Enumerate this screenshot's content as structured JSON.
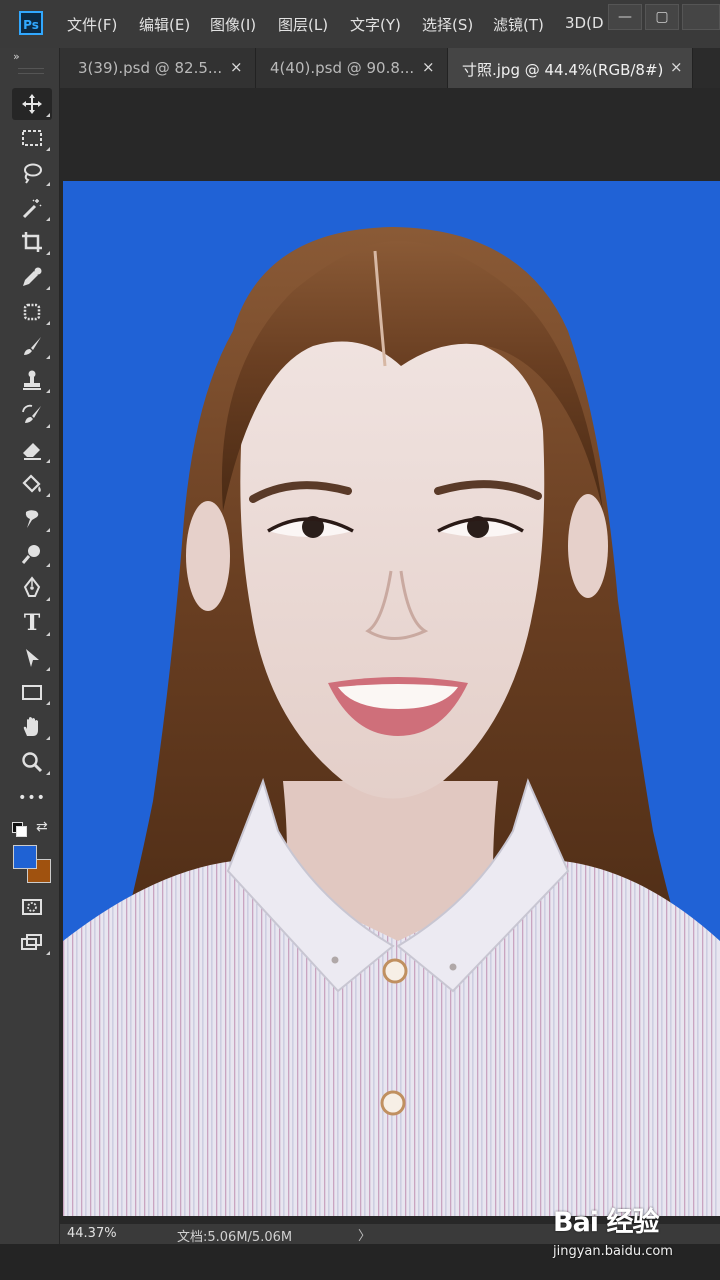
{
  "app": {
    "logo": "Ps"
  },
  "menu": [
    {
      "label": "文件(F)"
    },
    {
      "label": "编辑(E)"
    },
    {
      "label": "图像(I)"
    },
    {
      "label": "图层(L)"
    },
    {
      "label": "文字(Y)"
    },
    {
      "label": "选择(S)"
    },
    {
      "label": "滤镜(T)"
    },
    {
      "label": "3D(D"
    }
  ],
  "window_controls": {
    "minimize": "—",
    "restore": "▢"
  },
  "tabs": [
    {
      "label": "3(39).psd @ 82.5...",
      "close": "×",
      "active": false
    },
    {
      "label": "4(40).psd @ 90.8...",
      "close": "×",
      "active": false
    },
    {
      "label": "寸照.jpg @ 44.4%(RGB/8#)",
      "close": "×",
      "active": true
    }
  ],
  "toolbar": {
    "collapse": "»",
    "tools": [
      {
        "icon": "move-icon",
        "selected": true
      },
      {
        "icon": "marquee-icon"
      },
      {
        "icon": "lasso-icon"
      },
      {
        "icon": "magic-wand-icon"
      },
      {
        "icon": "crop-icon"
      },
      {
        "icon": "eyedropper-icon"
      },
      {
        "icon": "patch-icon"
      },
      {
        "icon": "brush-icon"
      },
      {
        "icon": "clone-stamp-icon"
      },
      {
        "icon": "history-brush-icon"
      },
      {
        "icon": "eraser-icon"
      },
      {
        "icon": "paint-bucket-icon"
      },
      {
        "icon": "smudge-icon"
      },
      {
        "icon": "dodge-icon"
      },
      {
        "icon": "pen-icon"
      },
      {
        "icon": "type-icon",
        "glyph": "T"
      },
      {
        "icon": "path-select-icon"
      },
      {
        "icon": "rectangle-icon"
      },
      {
        "icon": "hand-icon"
      },
      {
        "icon": "zoom-icon"
      },
      {
        "icon": "more-tools-icon",
        "glyph": "•••"
      }
    ],
    "foreground_color": "#1f62d4",
    "background_color": "#a0520f"
  },
  "document": {
    "background_color": "#2062d6"
  },
  "status": {
    "zoom": "44.37%",
    "doc_size": "文档:5.06M/5.06M",
    "arrow": "〉"
  },
  "watermark": {
    "logo": "Bai 经验",
    "url": "jingyan.baidu.com"
  }
}
